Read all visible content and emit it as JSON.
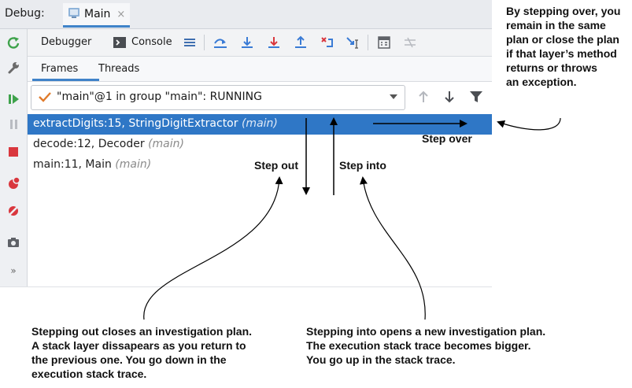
{
  "window": {
    "debug_label": "Debug:",
    "tab_label": "Main",
    "tab_close": "×"
  },
  "toolbar": {
    "debugger_tab": "Debugger",
    "console_tab": "Console",
    "icons": [
      "menu-icon",
      "show-execution-point-icon",
      "step-over-icon",
      "step-into-icon",
      "force-step-into-icon",
      "step-out-icon",
      "drop-frame-icon",
      "run-to-cursor-icon",
      "evaluate-expression-icon",
      "trace-icon"
    ]
  },
  "subtabs": {
    "frames": "Frames",
    "threads": "Threads"
  },
  "thread_selector": {
    "value": "\"main\"@1 in group \"main\": RUNNING"
  },
  "frames": [
    {
      "method": "extractDigits:15, StringDigitExtractor",
      "thread": "(main)",
      "selected": true
    },
    {
      "method": "decode:12, Decoder",
      "thread": "(main)",
      "selected": false
    },
    {
      "method": "main:11, Main",
      "thread": "(main)",
      "selected": false
    }
  ],
  "sidebar_icons": [
    "rerun-icon",
    "settings-wrench-icon",
    "resume-icon",
    "pause-icon",
    "stop-icon",
    "view-breakpoints-icon",
    "mute-breakpoints-icon",
    "camera-icon",
    "more-icon"
  ],
  "annotations": {
    "step_over": "Step over",
    "step_out": "Step out",
    "step_into": "Step into",
    "step_over_note": "By stepping over, you\nremain in the same\nplan or close the plan\nif that layer’s method\nreturns or throws\nan exception.",
    "step_out_note": "Stepping out closes an investigation plan.\nA stack layer dissapears as you return to\nthe previous one. You go down in the\nexecution stack trace.",
    "step_into_note": "Stepping into opens a new investigation plan.\nThe execution stack trace becomes bigger.\nYou go up in the stack trace."
  },
  "colors": {
    "selection": "#2f77c6",
    "accent_blue": "#4083c9",
    "stop_red": "#d9373e",
    "resume_green": "#3ea24b"
  }
}
